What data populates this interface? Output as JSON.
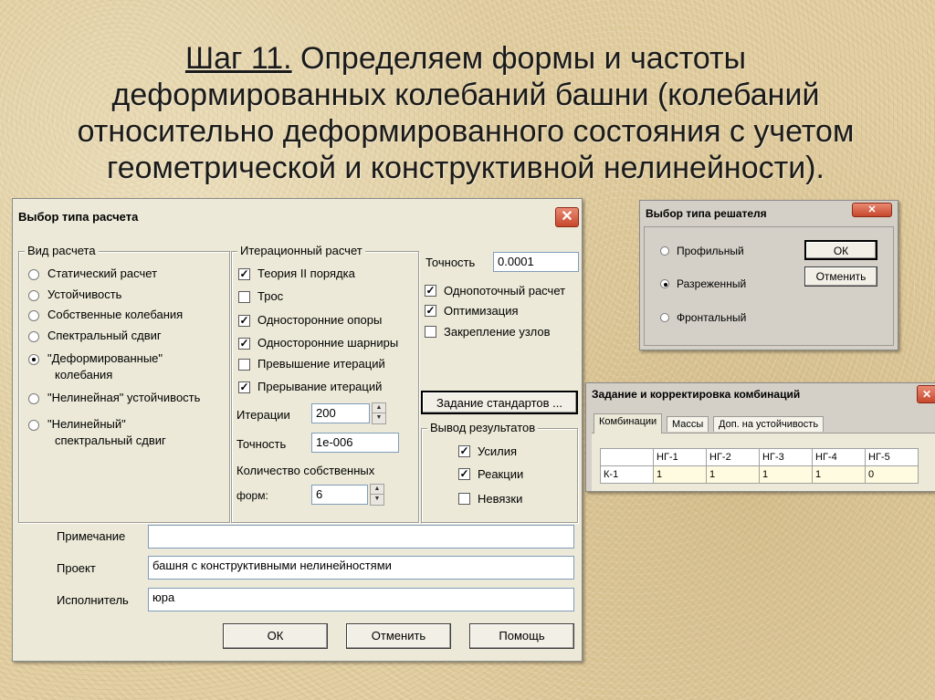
{
  "slide": {
    "step": "Шаг 11.",
    "title_line1": " Определяем формы и частоты",
    "title_line2": "деформированных колебаний башни (колебаний",
    "title_line3": "относительно деформированного состояния с учетом",
    "title_line4": "геометрической и конструктивной нелинейности)."
  },
  "calc_dialog": {
    "title": "Выбор типа расчета",
    "close": "✕",
    "calc_group": {
      "title": "Вид расчета",
      "options": [
        {
          "label": "Статический расчет",
          "selected": false
        },
        {
          "label": "Устойчивость",
          "selected": false
        },
        {
          "label": "Собственные колебания",
          "selected": false
        },
        {
          "label": "Спектральный сдвиг",
          "selected": false
        },
        {
          "label": "\"Деформированные\"",
          "label2": "колебания",
          "selected": true
        },
        {
          "label": "\"Нелинейная\" устойчивость",
          "selected": false
        },
        {
          "label": "\"Нелинейный\"",
          "label2": "спектральный сдвиг",
          "selected": false
        }
      ]
    },
    "iter_group": {
      "title": "Итерационный расчет",
      "checks": [
        {
          "label": "Теория II порядка",
          "checked": true
        },
        {
          "label": "Трос",
          "checked": false
        },
        {
          "label": "Односторонние опоры",
          "checked": true
        },
        {
          "label": "Односторонние шарниры",
          "checked": true
        },
        {
          "label": "Превышение итераций",
          "checked": false
        },
        {
          "label": "Прерывание итераций",
          "checked": true
        }
      ],
      "iterations_label": "Итерации",
      "iterations_value": "200",
      "precision_label": "Точность",
      "precision_value": "1e-006",
      "eigen_label1": "Количество собственных",
      "eigen_label2": "форм:",
      "eigen_value": "6"
    },
    "right": {
      "precision_label": "Точность",
      "precision_value": "0.0001",
      "checks": [
        {
          "label": "Однопоточный расчет",
          "checked": true
        },
        {
          "label": "Оптимизация",
          "checked": true
        },
        {
          "label": "Закрепление узлов",
          "checked": false
        }
      ],
      "standards_button": "Задание стандартов ...",
      "output_group": {
        "title": "Вывод результатов",
        "checks": [
          {
            "label": "Усилия",
            "checked": true
          },
          {
            "label": "Реакции",
            "checked": true
          },
          {
            "label": "Невязки",
            "checked": false
          }
        ]
      }
    },
    "note_label": "Примечание",
    "note_value": "",
    "project_label": "Проект",
    "project_value": "башня с конструктивными нелинейностями",
    "executor_label": "Исполнитель",
    "executor_value": "юра",
    "ok": "ОК",
    "cancel": "Отменить",
    "help": "Помощь"
  },
  "solver_dialog": {
    "title": "Выбор типа решателя",
    "close": "✕",
    "options": [
      {
        "label": "Профильный",
        "selected": false
      },
      {
        "label": "Разреженный",
        "selected": true
      },
      {
        "label": "Фронтальный",
        "selected": false
      }
    ],
    "ok": "ОК",
    "cancel": "Отменить"
  },
  "combo_dialog": {
    "title": "Задание и корректировка комбинаций",
    "close": "✕",
    "tabs": [
      "Комбинации",
      "Массы",
      "Доп. на устойчивость"
    ],
    "columns": [
      "",
      "НГ-1",
      "НГ-2",
      "НГ-3",
      "НГ-4",
      "НГ-5"
    ],
    "rows": [
      [
        "К-1",
        "1",
        "1",
        "1",
        "1",
        "0"
      ]
    ]
  },
  "colors": {
    "background": "#e2cfa2",
    "dialog": "#ece9d8",
    "close_button": "#c7482c",
    "grid_row": "#fffbe0"
  }
}
